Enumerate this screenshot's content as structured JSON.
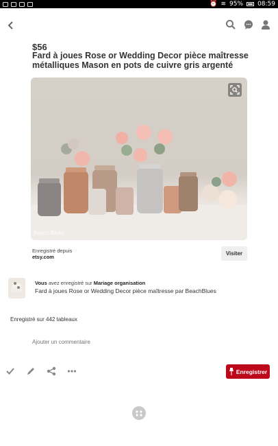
{
  "status": {
    "battery": "95%",
    "time": "08:59"
  },
  "pin": {
    "price": "$56",
    "title": "Fard à joues Rose or Wedding Decor pièce maîtresse métalliques Mason en pots de cuivre gris argenté",
    "watermark": "Beach Blues"
  },
  "source": {
    "label": "Enregistré depuis",
    "domain": "etsy.com",
    "visit_label": "Visiter"
  },
  "activity": {
    "you": "Vous",
    "action": " avez enregistré sur ",
    "board": "Mariage organisation",
    "description": "Fard à joues Rose or Wedding Decor pièce maîtresse par BeachBlues"
  },
  "saved_count": "Enregistré sur 442 tableaux",
  "comment": {
    "placeholder": "Ajouter un commentaire"
  },
  "actions": {
    "save_label": "Enregistrer"
  },
  "colors": {
    "save_red": "#bd081c",
    "icon_gray": "#777777"
  },
  "icons": [
    "back-icon",
    "search-icon",
    "chat-icon",
    "profile-icon",
    "visual-search-icon",
    "check-icon",
    "edit-icon",
    "share-icon",
    "more-icon",
    "pin-icon",
    "dots-icon"
  ]
}
